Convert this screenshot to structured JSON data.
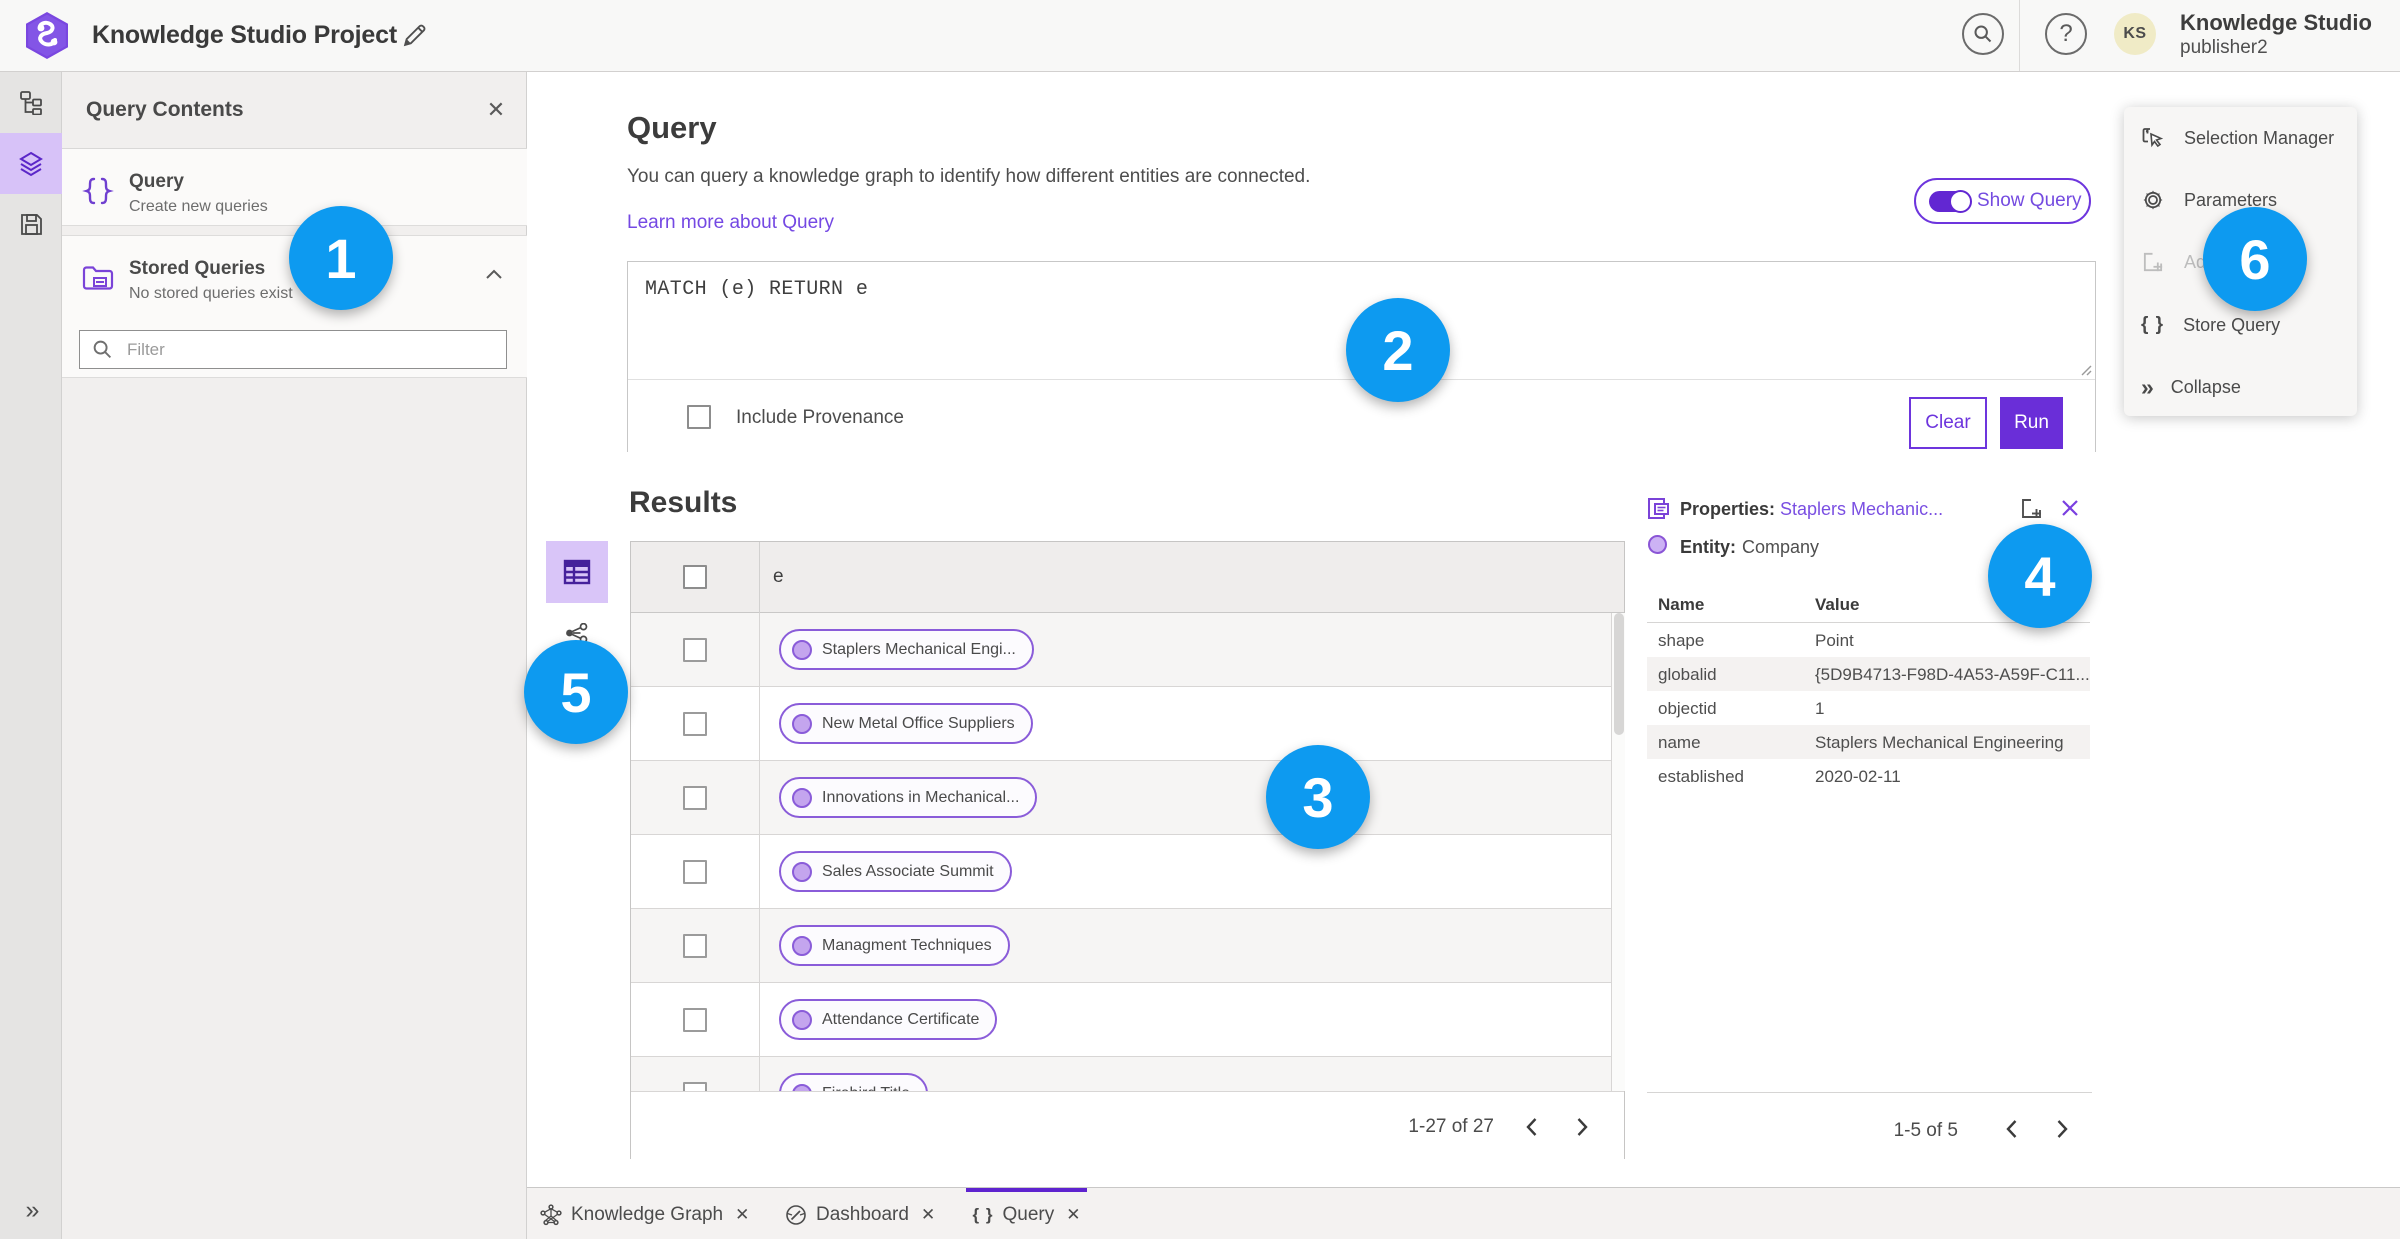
{
  "colors": {
    "accent_purple": "#6a2ed8",
    "link_purple": "#7448e3",
    "pill_border_purple": "#8a5cd9",
    "rail_active_bg": "#d7c2f8",
    "callout_blue": "#0d9af0",
    "avatar_bg": "#f0ebc6"
  },
  "header": {
    "title": "Knowledge Studio Project",
    "help_glyph": "?",
    "user": {
      "initials": "KS",
      "name": "Knowledge Studio",
      "username": "publisher2"
    }
  },
  "rail": {
    "expand_glyph": "»"
  },
  "contents_panel": {
    "title": "Query Contents",
    "close_glyph": "✕",
    "query_item": {
      "title": "Query",
      "subtitle": "Create new queries"
    },
    "stored_item": {
      "title": "Stored Queries",
      "subtitle": "No stored queries exist"
    },
    "filter_placeholder": "Filter"
  },
  "query_panel": {
    "heading": "Query",
    "description": "You can query a knowledge graph to identify how different entities are connected.",
    "learn_more_link": "Learn more about Query",
    "show_query_label": "Show Query",
    "editor_text": "MATCH (e) RETURN e",
    "include_provenance_label": "Include Provenance",
    "clear_button": "Clear",
    "run_button": "Run"
  },
  "results_panel": {
    "heading": "Results",
    "column_header": "e",
    "rows": [
      {
        "label": "Staplers Mechanical Engi..."
      },
      {
        "label": "New Metal Office Suppliers"
      },
      {
        "label": "Innovations in Mechanical..."
      },
      {
        "label": "Sales Associate Summit"
      },
      {
        "label": "Managment Techniques"
      },
      {
        "label": "Attendance Certificate"
      },
      {
        "label": "Firebird Title"
      }
    ],
    "pagination": "1-27 of 27"
  },
  "properties_panel": {
    "heading": "Properties:",
    "selected_entity": "Staplers Mechanic...",
    "entity_label": "Entity:",
    "entity_type": "Company",
    "close_glyph": "✕",
    "columns": {
      "name": "Name",
      "value": "Value"
    },
    "rows": [
      {
        "name": "shape",
        "value": "Point"
      },
      {
        "name": "globalid",
        "value": "{5D9B4713-F98D-4A53-A59F-C11..."
      },
      {
        "name": "objectid",
        "value": "1"
      },
      {
        "name": "name",
        "value": "Staplers Mechanical Engineering"
      },
      {
        "name": "established",
        "value": "2020-02-11"
      }
    ],
    "pagination": "1-5 of 5"
  },
  "actions_menu": {
    "selection_manager": "Selection Manager",
    "parameters": "Parameters",
    "add_disabled": "Ad",
    "store_query": "Store Query",
    "collapse": "Collapse",
    "store_query_glyph": "{ }",
    "collapse_glyph": "»"
  },
  "bottom_tabs": {
    "knowledge_graph": "Knowledge Graph",
    "dashboard": "Dashboard",
    "query": "Query",
    "close_glyph": "✕",
    "query_glyph": "{ }"
  },
  "callouts": [
    {
      "number": "1"
    },
    {
      "number": "2"
    },
    {
      "number": "3"
    },
    {
      "number": "4"
    },
    {
      "number": "5"
    },
    {
      "number": "6"
    }
  ]
}
